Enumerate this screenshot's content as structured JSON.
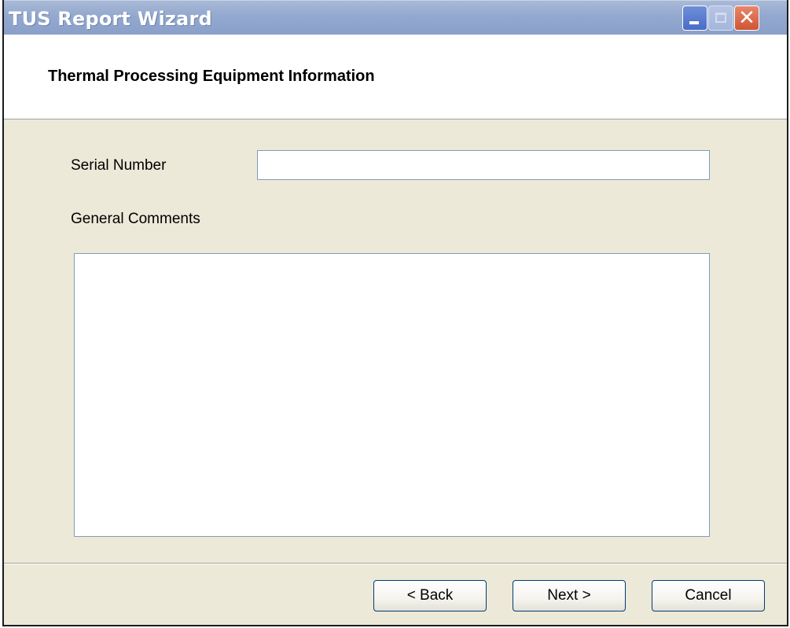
{
  "window": {
    "title": "TUS Report Wizard",
    "controls": {
      "minimize_icon": "minimize-icon",
      "maximize_icon": "maximize-icon",
      "close_icon": "close-icon",
      "close_glyph": "✕"
    }
  },
  "header": {
    "title": "Thermal Processing Equipment Information"
  },
  "form": {
    "serial_number": {
      "label": "Serial Number",
      "value": ""
    },
    "general_comments": {
      "label": "General Comments",
      "value": ""
    }
  },
  "footer": {
    "back_label": "< Back",
    "next_label": "Next >",
    "cancel_label": "Cancel"
  },
  "colors": {
    "titlebar": "#93a8cf",
    "dialog_background": "#ece9d8",
    "button_border": "#003c74"
  }
}
